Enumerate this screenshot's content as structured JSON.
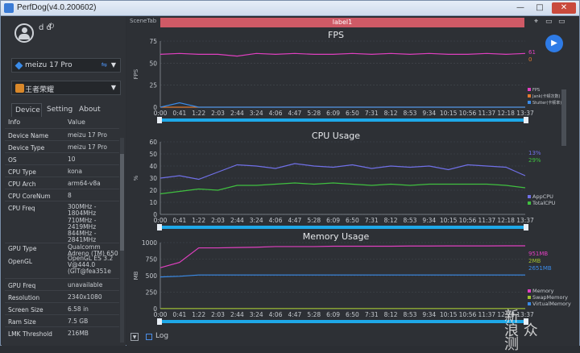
{
  "window": {
    "title": "PerfDog(v4.0.200602)",
    "min": "—",
    "max": "□",
    "close": "✕"
  },
  "user": {
    "name": "d d"
  },
  "device_select": {
    "label": "meizu 17 Pro"
  },
  "app_select": {
    "label": "王者荣耀"
  },
  "tabs": [
    "Device",
    "Setting",
    "About"
  ],
  "info": {
    "header": {
      "k": "Info",
      "v": "Value"
    },
    "rows": [
      {
        "k": "Device Name",
        "v": "meizu 17 Pro"
      },
      {
        "k": "Device Type",
        "v": "meizu 17 Pro"
      },
      {
        "k": "OS",
        "v": "10"
      },
      {
        "k": "CPU Type",
        "v": "kona"
      },
      {
        "k": "CPU Arch",
        "v": "arm64-v8a"
      },
      {
        "k": "CPU CoreNum",
        "v": "8"
      },
      {
        "k": "CPU Freq",
        "v": "300MHz -\n1804MHz\n710MHz -\n2419MHz\n844MHz -\n2841MHz"
      },
      {
        "k": "GPU Type",
        "v": "Qualcomm\nAdreno (TM) 650"
      },
      {
        "k": "OpenGL",
        "v": "OpenGL ES 3.2\nV@444.0\n(GIT@fea351e"
      },
      {
        "k": "GPU Freq",
        "v": "unavailable"
      },
      {
        "k": "Resolution",
        "v": "2340x1080"
      },
      {
        "k": "Screen Size",
        "v": "6.58 in"
      },
      {
        "k": "Ram Size",
        "v": "7.5 GB"
      },
      {
        "k": "LMK Threshold",
        "v": "216MB"
      }
    ]
  },
  "scene": {
    "tab_label": "SceneTab",
    "label": "label1"
  },
  "bottom": {
    "log_label": "Log"
  },
  "watermark": "新\n浪 众\n测",
  "colors": {
    "fps": "#e040c0",
    "jank": "#e07a30",
    "stutter": "#3a8be8",
    "app_cpu": "#7070e8",
    "total_cpu": "#40c040",
    "memory": "#e040c0",
    "swap": "#a0c030",
    "virtual": "#3a8be8",
    "slider": "#1ea8e8"
  },
  "time_ticks": [
    "0:00",
    "0:41",
    "1:22",
    "2:03",
    "2:44",
    "3:24",
    "4:06",
    "4:47",
    "5:28",
    "6:09",
    "6:50",
    "7:31",
    "8:12",
    "8:53",
    "9:34",
    "10:15",
    "10:56",
    "11:37",
    "12:18",
    "13:37"
  ],
  "chart_data": [
    {
      "type": "line",
      "title": "FPS",
      "ylabel": "FPS",
      "ylim": [
        0,
        75
      ],
      "yticks": [
        0,
        25,
        50,
        75
      ],
      "yticks_all": [
        "75",
        "50",
        "25",
        "0"
      ],
      "ylabels_shown": [
        "0",
        "25",
        "50",
        "75"
      ],
      "current_values": [
        "61",
        "0"
      ],
      "legend": [
        "FPS",
        "Jank(卡顿次数)",
        "Stutter(卡顿率)"
      ],
      "series": [
        {
          "name": "FPS",
          "values": [
            60,
            61,
            60,
            60,
            58,
            61,
            60,
            61,
            60,
            60,
            61,
            60,
            61,
            60,
            61,
            60,
            60,
            61,
            60,
            61
          ]
        },
        {
          "name": "Jank(卡顿次数)",
          "values": [
            0,
            0,
            0,
            0,
            0,
            0,
            0,
            0,
            0,
            0,
            0,
            0,
            0,
            0,
            0,
            0,
            0,
            0,
            0,
            0
          ]
        },
        {
          "name": "Stutter(卡顿率)",
          "values": [
            0,
            5,
            0,
            0,
            0,
            0,
            0,
            0,
            0,
            0,
            0,
            0,
            0,
            0,
            0,
            0,
            0,
            0,
            0,
            0
          ]
        }
      ]
    },
    {
      "type": "line",
      "title": "CPU Usage",
      "ylabel": "%",
      "ylim": [
        0,
        60
      ],
      "yticks": [
        0,
        10,
        20,
        30,
        40,
        50,
        60
      ],
      "current_values": [
        "13%",
        "29%"
      ],
      "legend": [
        "AppCPU",
        "TotalCPU"
      ],
      "series": [
        {
          "name": "AppCPU",
          "values": [
            30,
            32,
            29,
            35,
            41,
            40,
            38,
            42,
            40,
            39,
            41,
            38,
            40,
            39,
            40,
            37,
            41,
            40,
            39,
            32
          ]
        },
        {
          "name": "TotalCPU",
          "values": [
            17,
            19,
            21,
            20,
            24,
            24,
            25,
            26,
            25,
            26,
            25,
            24,
            25,
            24,
            25,
            25,
            25,
            25,
            24,
            22
          ]
        }
      ]
    },
    {
      "type": "line",
      "title": "Memory Usage",
      "ylabel": "MB",
      "ylim": [
        0,
        1000
      ],
      "yticks": [
        0,
        250,
        500,
        750,
        1000
      ],
      "current_values": [
        "951MB",
        "2MB",
        "2651MB"
      ],
      "legend": [
        "Memory",
        "SwapMemory",
        "VirtualMemory"
      ],
      "series": [
        {
          "name": "Memory",
          "values": [
            620,
            700,
            920,
            920,
            925,
            930,
            940,
            940,
            940,
            945,
            945,
            945,
            945,
            948,
            948,
            950,
            950,
            950,
            951,
            951
          ]
        },
        {
          "name": "SwapMemory",
          "values": [
            2,
            2,
            2,
            2,
            2,
            2,
            2,
            2,
            2,
            2,
            2,
            2,
            2,
            2,
            2,
            2,
            2,
            2,
            2,
            2
          ]
        },
        {
          "name": "VirtualMemory",
          "values": [
            480,
            490,
            510,
            510,
            510,
            510,
            510,
            510,
            510,
            510,
            510,
            510,
            510,
            510,
            510,
            510,
            510,
            510,
            510,
            510
          ]
        }
      ]
    }
  ]
}
